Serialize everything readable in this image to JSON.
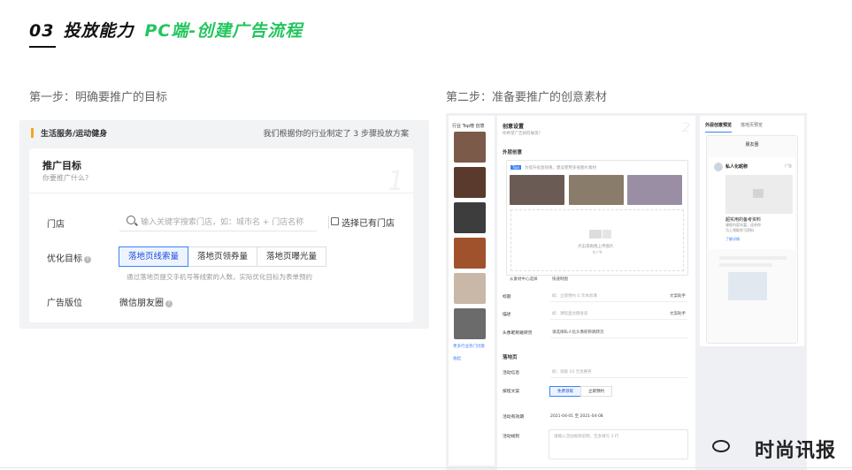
{
  "header": {
    "number": "03",
    "title": "投放能力",
    "subtitle": "PC端-创建广告流程"
  },
  "steps": {
    "step1": "第一步：明确要推广的目标",
    "step2": "第二步：准备要推广的创意素材"
  },
  "left_panel": {
    "category": "生活服务/运动健身",
    "tip": "我们根据你的行业制定了 3 步骤投放方案",
    "card_title": "推广目标",
    "card_sub": "你要推广什么?",
    "watermark": "1",
    "store_label": "门店",
    "store_placeholder": "输入关键字搜索门店，如：城市名 + 门店名称",
    "pick_store": "选择已有门店",
    "goal_label": "优化目标",
    "goal_options": [
      "落地页线索量",
      "落地页领券量",
      "落地页曝光量"
    ],
    "goal_hint": "通过落地页提交手机号等线索的人数，实际优化目标为表单预约",
    "position_label": "广告版位",
    "position_value": "微信朋友圈"
  },
  "right_panel": {
    "top_label": "行业 Top榜 创意",
    "more_link": "更多行业热门创意",
    "collapse": "收起",
    "form_title": "创意设置",
    "form_sub": "你希望广告如何展现?",
    "watermark": "2",
    "ext_section": "外层创意",
    "upload_tag": "Tips",
    "upload_tip": "为提升投放效果，建议使用多张图片素材",
    "upload_drop": "点击或拖拽上传图片",
    "upload_count": "0 / 9",
    "asset_center": "从素材中心选择",
    "quick_make": "快速制图",
    "labels": {
      "title": "标题",
      "desc": "描述",
      "avatar": "头像昵称跳转页",
      "landing": "落地页",
      "activity": "活动信息",
      "button": "按钮文案",
      "date": "活动有效期",
      "rules": "活动规则"
    },
    "title_ph": "如：立即预约 0 元体验课",
    "desc_ph": "如：课程直达健身房",
    "avatar_ph": "请选择私人化头像昵称跳转页",
    "activity_ph": "如：领取 10 元优惠券",
    "button_options": [
      "免费领取",
      "立即预约"
    ],
    "date_value": "2021-04-01 至 2021-04-08",
    "rules_ph": "请输入活动规则说明，至多填写 3 行",
    "helper": "文案助手",
    "preview_tabs": [
      "外层创意预览",
      "落地页预览"
    ],
    "phone_title": "朋友圈",
    "ad_name": "私人化昵称",
    "ad_tag": "广告",
    "ad_line1": "超实用的备考资料",
    "ad_line2": "课程内容丰富，适合你",
    "ad_line3": "马上领取学习资料",
    "ad_cta": "了解详情"
  },
  "watermark": "时尚讯报",
  "colors": {
    "accent": "#22c55e",
    "primary": "#3b82f6",
    "bar": "#f5a623"
  }
}
